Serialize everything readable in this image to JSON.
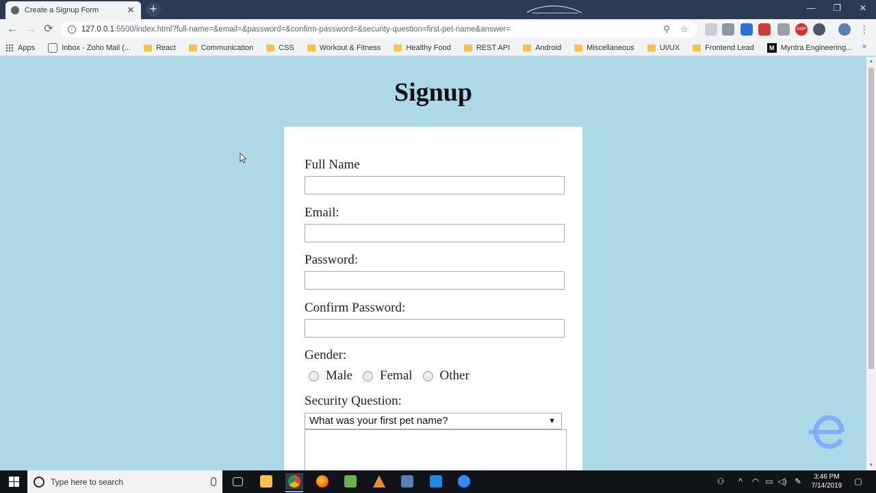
{
  "browser": {
    "tab_title": "Create a Signup Form",
    "tab_close": "✕",
    "new_tab": "+",
    "url_host": "127.0.0.1",
    "url_rest": ":5500/index.html?full-name=&email=&password=&confirm-password=&security-question=first-pet-name&answer=",
    "window": {
      "minimize": "—",
      "restore": "❐",
      "close": "✕"
    },
    "nav": {
      "back": "←",
      "forward": "→",
      "reload": "⟳"
    },
    "omni_icons": {
      "zoom": "⚲",
      "star": "☆"
    },
    "extension_abp": "ABP"
  },
  "bookmarks": [
    {
      "label": "Apps",
      "icon": "apps-grid-icon"
    },
    {
      "label": "Inbox - Zoho Mail (...",
      "icon": "zoho-icon"
    },
    {
      "label": "React",
      "icon": "folder-icon"
    },
    {
      "label": "Communication",
      "icon": "folder-icon"
    },
    {
      "label": "CSS",
      "icon": "folder-icon"
    },
    {
      "label": "Workout & Fitness",
      "icon": "folder-icon"
    },
    {
      "label": "Healthy Food",
      "icon": "folder-icon"
    },
    {
      "label": "REST API",
      "icon": "folder-icon"
    },
    {
      "label": "Android",
      "icon": "folder-icon"
    },
    {
      "label": "Miscellaneous",
      "icon": "folder-icon"
    },
    {
      "label": "UI/UX",
      "icon": "folder-icon"
    },
    {
      "label": "Frontend Lead",
      "icon": "folder-icon"
    },
    {
      "label": "Myntra Engineering...",
      "icon": "medium-icon"
    }
  ],
  "bookmarks_more": "»",
  "bookmark_medium_letter": "M",
  "page": {
    "title": "Signup",
    "labels": {
      "full_name": "Full Name",
      "email": "Email:",
      "password": "Password:",
      "confirm_password": "Confirm Password:",
      "gender": "Gender:",
      "security_question": "Security Question:"
    },
    "gender_options": [
      "Male",
      "Femal",
      "Other"
    ],
    "security_question_selected": "What was your first pet name?",
    "select_arrow": "▼"
  },
  "scroll": {
    "up": "▲",
    "down": "▼"
  },
  "taskbar": {
    "search_placeholder": "Type here to search",
    "time": "3:46 PM",
    "date": "7/14/2019",
    "tray": {
      "people": "⚇",
      "chevron": "^",
      "wifi": "◠",
      "battery": "▭",
      "volume": "◁)",
      "pen": "✎",
      "notifications": "▢"
    }
  },
  "colors": {
    "page_background": "#add8e6",
    "card_background": "#ffffff",
    "titlebar": "#2b3a55",
    "taskbar": "#101318",
    "brand_logo": "#7fb0ff"
  }
}
